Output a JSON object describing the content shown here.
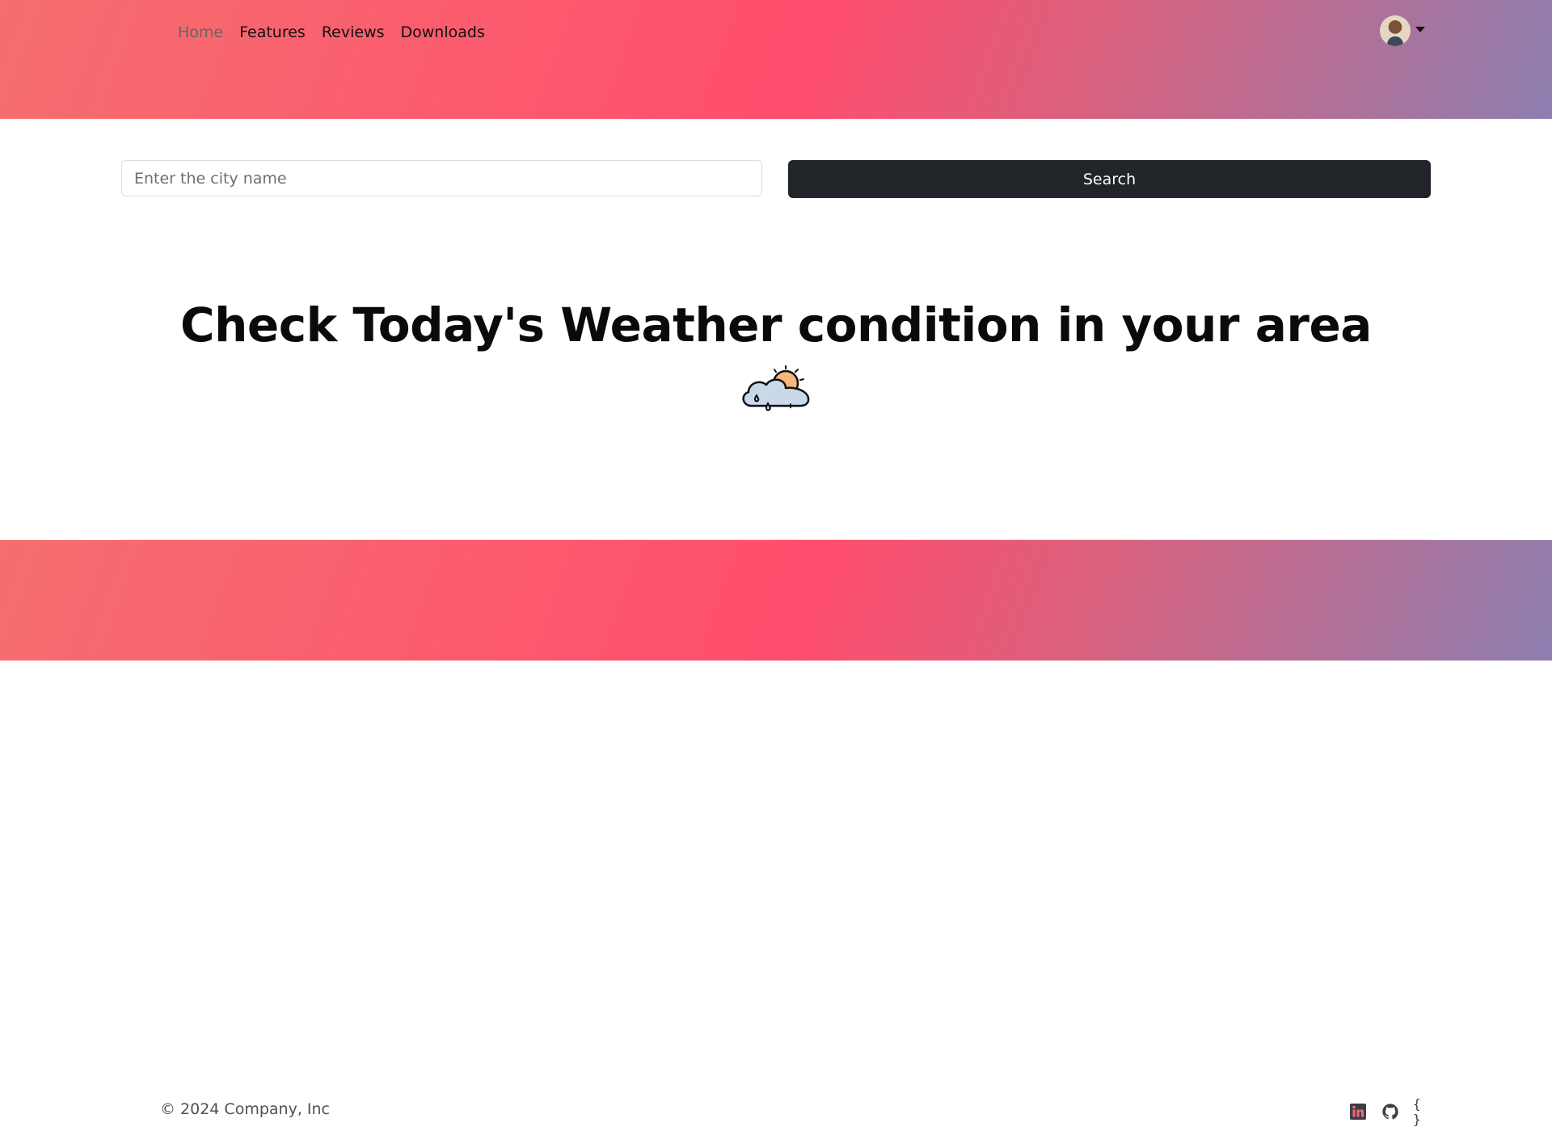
{
  "nav": {
    "items": [
      {
        "label": "Home",
        "active": true
      },
      {
        "label": "Features"
      },
      {
        "label": "Reviews"
      },
      {
        "label": "Downloads"
      }
    ]
  },
  "search": {
    "placeholder": "Enter the city name",
    "value": "",
    "button_label": "Search"
  },
  "hero": {
    "headline": "Check Today's Weather condition in your area",
    "icon": "cloud-sun-rain-icon"
  },
  "footer": {
    "copyright": "© 2024 Company, Inc",
    "braces_text": "{ }",
    "social_icons": [
      "linkedin-icon",
      "github-icon",
      "code-braces-icon"
    ]
  },
  "colors": {
    "gradient_start": "#f56f6f",
    "gradient_mid": "#ff4d6d",
    "gradient_end": "#8d7fb0",
    "button_bg": "#212529"
  }
}
